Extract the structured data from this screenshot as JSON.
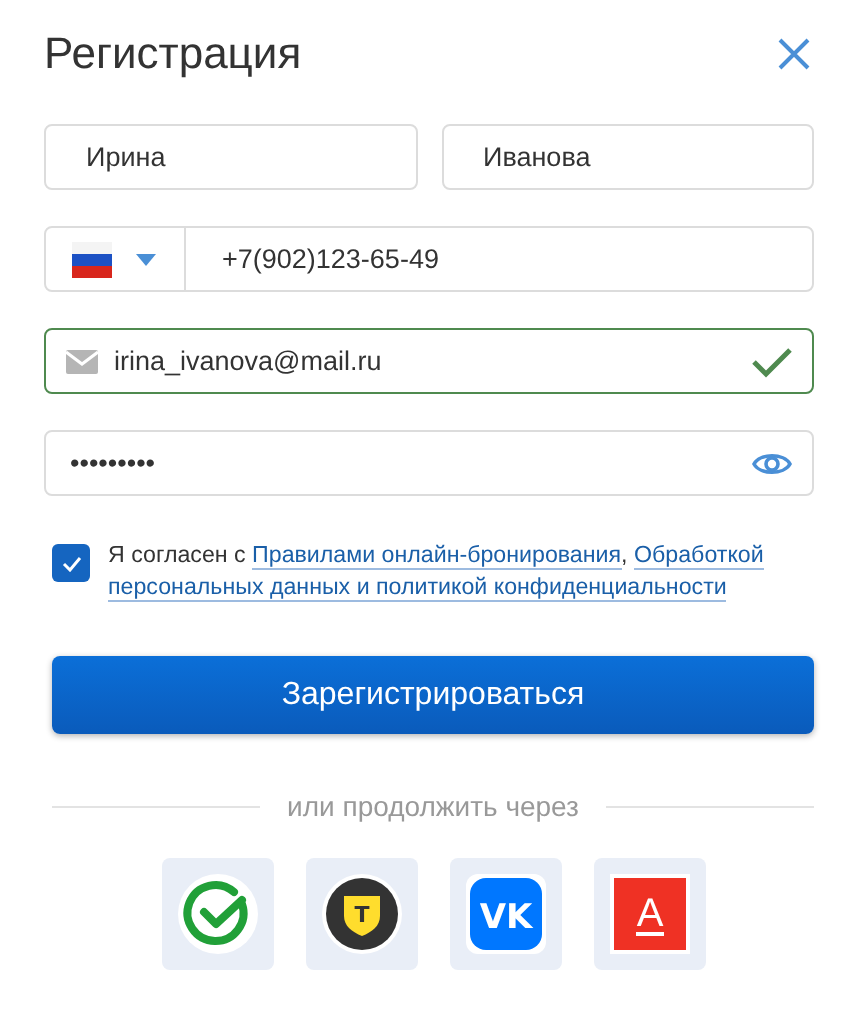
{
  "title": "Регистрация",
  "first_name": {
    "value": "Ирина"
  },
  "last_name": {
    "value": "Иванова"
  },
  "phone": {
    "value": "+7(902)123-65-49"
  },
  "email": {
    "value": "irina_ivanova@mail.ru",
    "valid": true
  },
  "password": {
    "value": "•••••••••"
  },
  "consent": {
    "checked": true,
    "parts": [
      {
        "kind": "text",
        "text": "Я согласен с "
      },
      {
        "kind": "link",
        "text": "Правилами онлайн-бронирования"
      },
      {
        "kind": "text",
        "text": ", "
      },
      {
        "kind": "link",
        "text": "Обработкой"
      },
      {
        "kind": "link",
        "text": "персональных данных и политикой конфиденциальности"
      }
    ]
  },
  "submit": "Зарегистрироваться",
  "divider": "или продолжить через",
  "providers": [
    {
      "kind": "sber"
    },
    {
      "kind": "tbank",
      "mark": "Т"
    },
    {
      "kind": "vk",
      "mark": "VK"
    },
    {
      "kind": "alfa",
      "mark": "А"
    }
  ]
}
